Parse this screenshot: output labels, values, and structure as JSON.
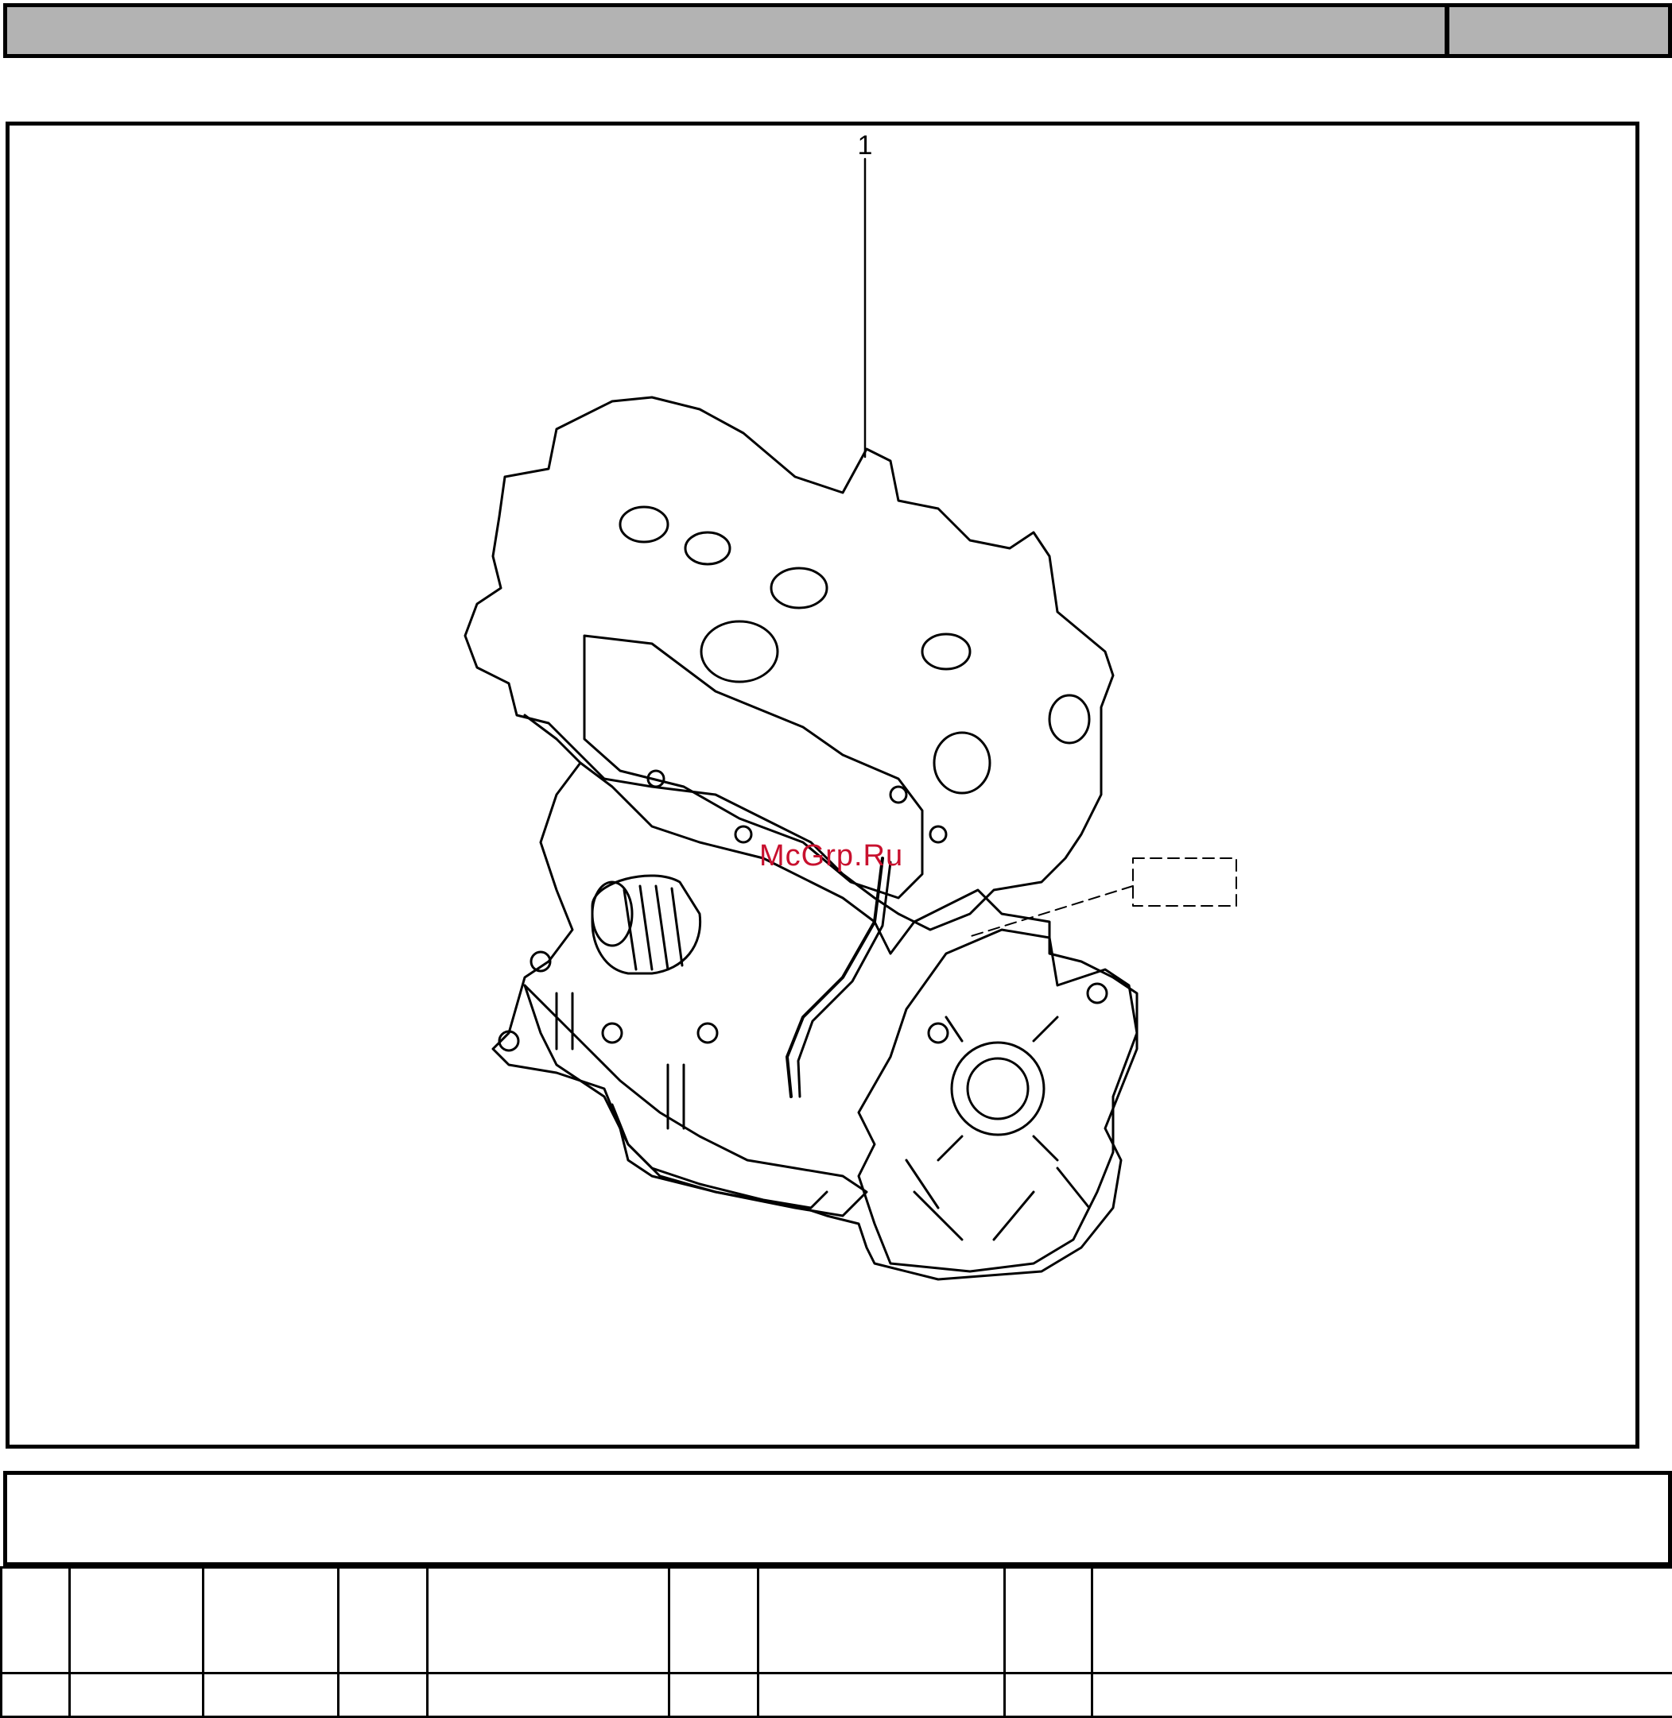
{
  "header": {
    "title": "",
    "page_ref": ""
  },
  "drawing": {
    "callout_label": "1",
    "watermark": "McGrp.Ru",
    "subject": "engine-assembly"
  },
  "caption": {
    "text": ""
  },
  "colors": {
    "header_fill": "#b3b3b3",
    "watermark": "#c8102e",
    "line": "#000000"
  },
  "parts_table": {
    "columns": 10,
    "rows": [
      [
        "",
        "",
        "",
        "",
        "",
        "",
        "",
        "",
        "",
        ""
      ],
      [
        "",
        "",
        "",
        "",
        "",
        "",
        "",
        "",
        "",
        ""
      ]
    ]
  }
}
